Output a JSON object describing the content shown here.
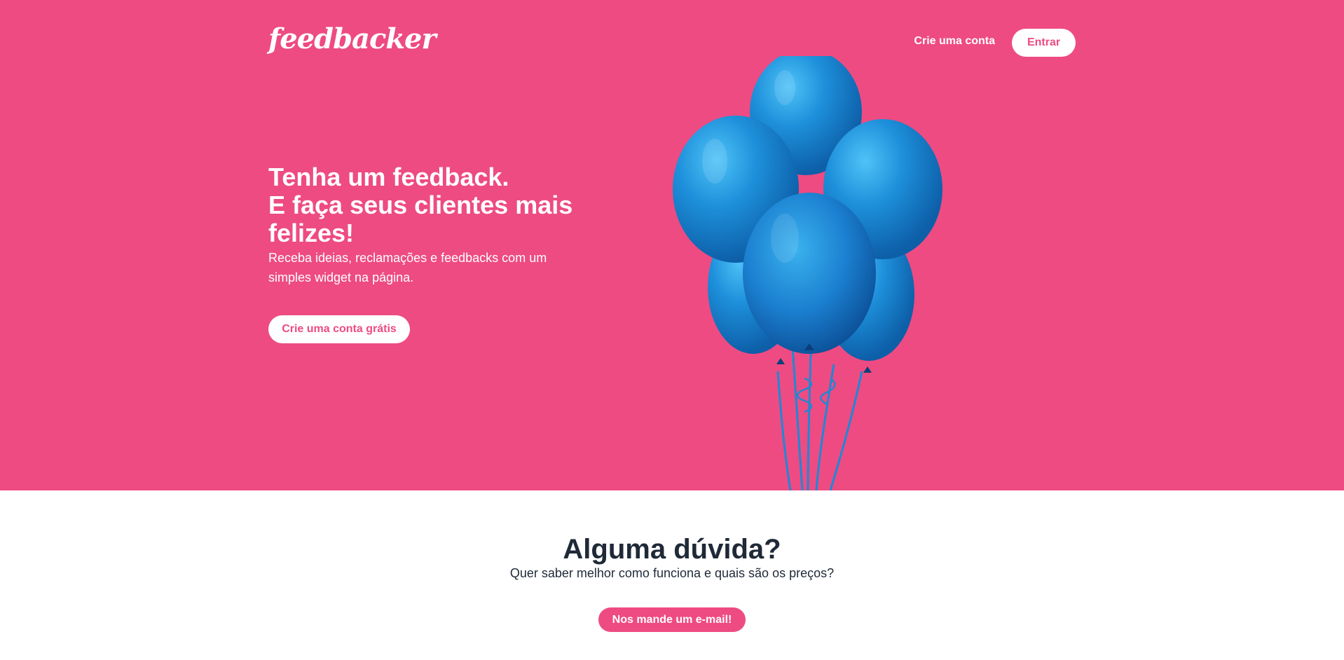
{
  "header": {
    "logo_text": "feedbacker",
    "nav_signup_label": "Crie uma conta",
    "login_button_label": "Entrar"
  },
  "hero": {
    "headline_lines": [
      "Tenha um feedback.",
      "E faça seus clientes mais",
      "felizes!"
    ],
    "subtext": "Receba ideias, reclamações e feedbacks com um simples widget na página.",
    "cta_label": "Crie uma conta grátis",
    "image": "blue-balloons-illustration"
  },
  "contact": {
    "title": "Alguma dúvida?",
    "subtitle": "Quer saber melhor como funciona e quais são os preços?",
    "button_label": "Nos mande um e-mail!"
  },
  "colors": {
    "brand_pink": "#EE4B82",
    "white": "#FFFFFF",
    "text_dark": "#1F2937",
    "balloon_blue": "#1E88D6"
  }
}
